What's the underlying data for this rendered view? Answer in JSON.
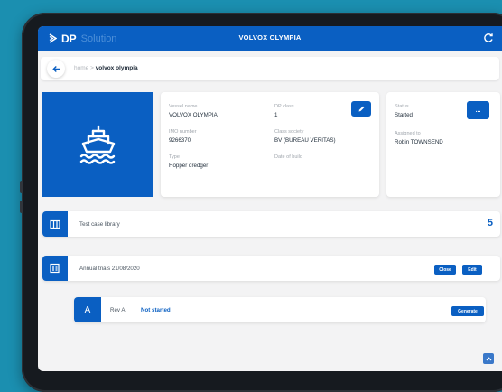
{
  "header": {
    "brand_short": "DP",
    "brand_rest": "Solution",
    "title": "VOLVOX OLYMPIA",
    "refresh_icon": "refresh-icon"
  },
  "breadcrumb": {
    "back_icon": "arrow-left-icon",
    "home": "home",
    "separator": ">",
    "current": "volvox olympia"
  },
  "vessel": {
    "image_icon": "ship-icon",
    "name_label": "Vessel name",
    "name": "VOLVOX OLYMPIA",
    "imo_label": "IMO number",
    "imo": "9266370",
    "type_label": "Type",
    "type": "Hopper dredger",
    "dp_class_label": "DP class",
    "dp_class": "1",
    "class_society_label": "Class society",
    "class_society": "BV (BUREAU VERITAS)",
    "build_label": "Date of build",
    "build": "",
    "edit_icon": "pencil-icon"
  },
  "status_card": {
    "status_label": "Status",
    "status": "Started",
    "assigned_label": "Assigned to",
    "assigned": "Robin TOWNSEND",
    "more_label": "..."
  },
  "library": {
    "label": "Test case library",
    "count": "5",
    "icon": "library-icon"
  },
  "trial": {
    "label": "Annual trials 21/08/2020",
    "close_label": "Close",
    "edit_label": "Edit",
    "icon": "document-list-icon"
  },
  "revision": {
    "badge": "A",
    "name": "Rev A",
    "status": "Not started",
    "generate_label": "Generate"
  },
  "colors": {
    "primary": "#0a5fc2",
    "background": "#1b8fb0"
  }
}
